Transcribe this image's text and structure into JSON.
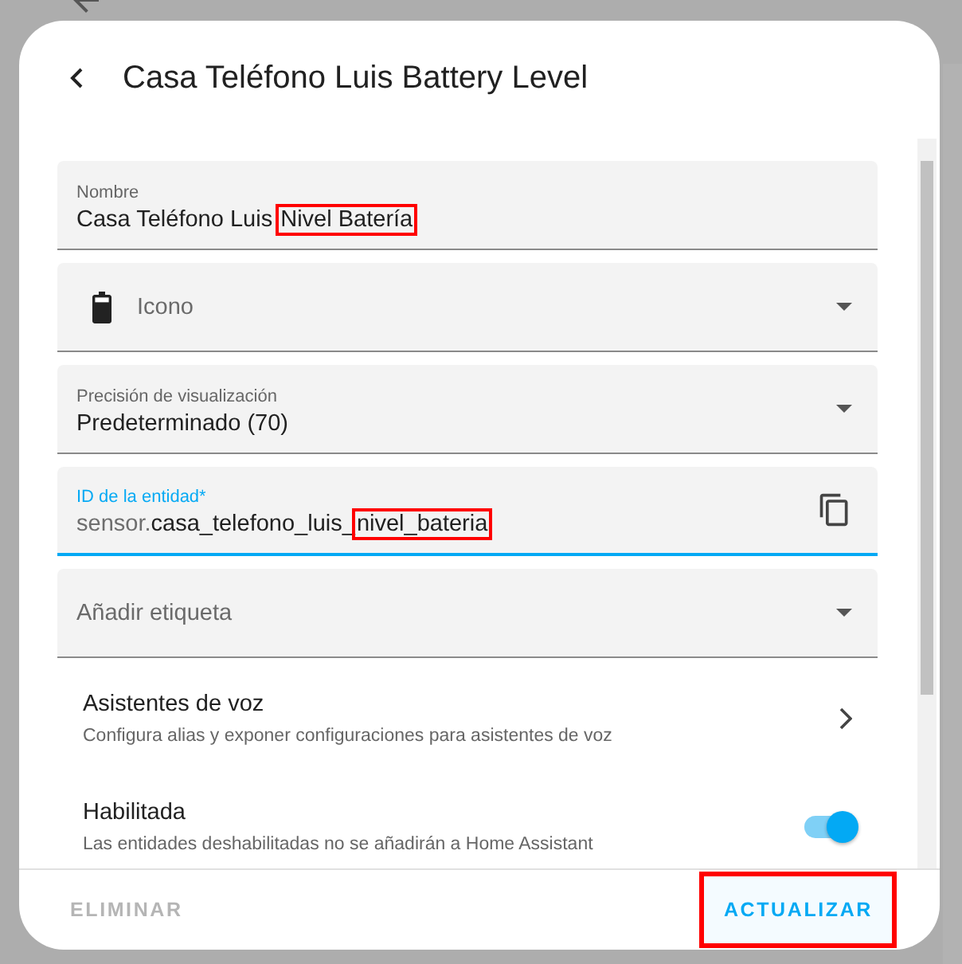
{
  "dialog": {
    "title": "Casa Teléfono Luis Battery Level",
    "fields": [
      {
        "kind": "text",
        "label": "Nombre",
        "focused": false,
        "segments": [
          {
            "text": "Casa Teléfono Luis ",
            "muted": false,
            "highlighted": false
          },
          {
            "text": "Nivel Batería",
            "muted": false,
            "highlighted": true
          }
        ]
      },
      {
        "kind": "icon-select",
        "placeholder": "Icono"
      },
      {
        "kind": "select",
        "label": "Precisión de visualización",
        "value": "Predeterminado (70)"
      },
      {
        "kind": "text",
        "label": "ID de la entidad*",
        "focused": true,
        "copy": true,
        "segments": [
          {
            "text": "sensor.",
            "muted": true,
            "highlighted": false
          },
          {
            "text": "casa_telefono_luis_",
            "muted": false,
            "highlighted": false
          },
          {
            "text": "nivel_bateria",
            "muted": false,
            "highlighted": true
          }
        ]
      },
      {
        "kind": "select",
        "placeholder": "Añadir etiqueta"
      }
    ],
    "rows": [
      {
        "kind": "link",
        "title": "Asistentes de voz",
        "subtitle": "Configura alias y exponer configuraciones para asistentes de voz"
      },
      {
        "kind": "switch",
        "title": "Habilitada",
        "subtitle": "Las entidades deshabilitadas no se añadirán a Home Assistant",
        "on": true
      }
    ],
    "buttons": [
      {
        "label": "ELIMINAR",
        "disabled": true,
        "highlighted": false
      },
      {
        "label": "ACTUALIZAR",
        "disabled": false,
        "highlighted": true
      }
    ]
  }
}
